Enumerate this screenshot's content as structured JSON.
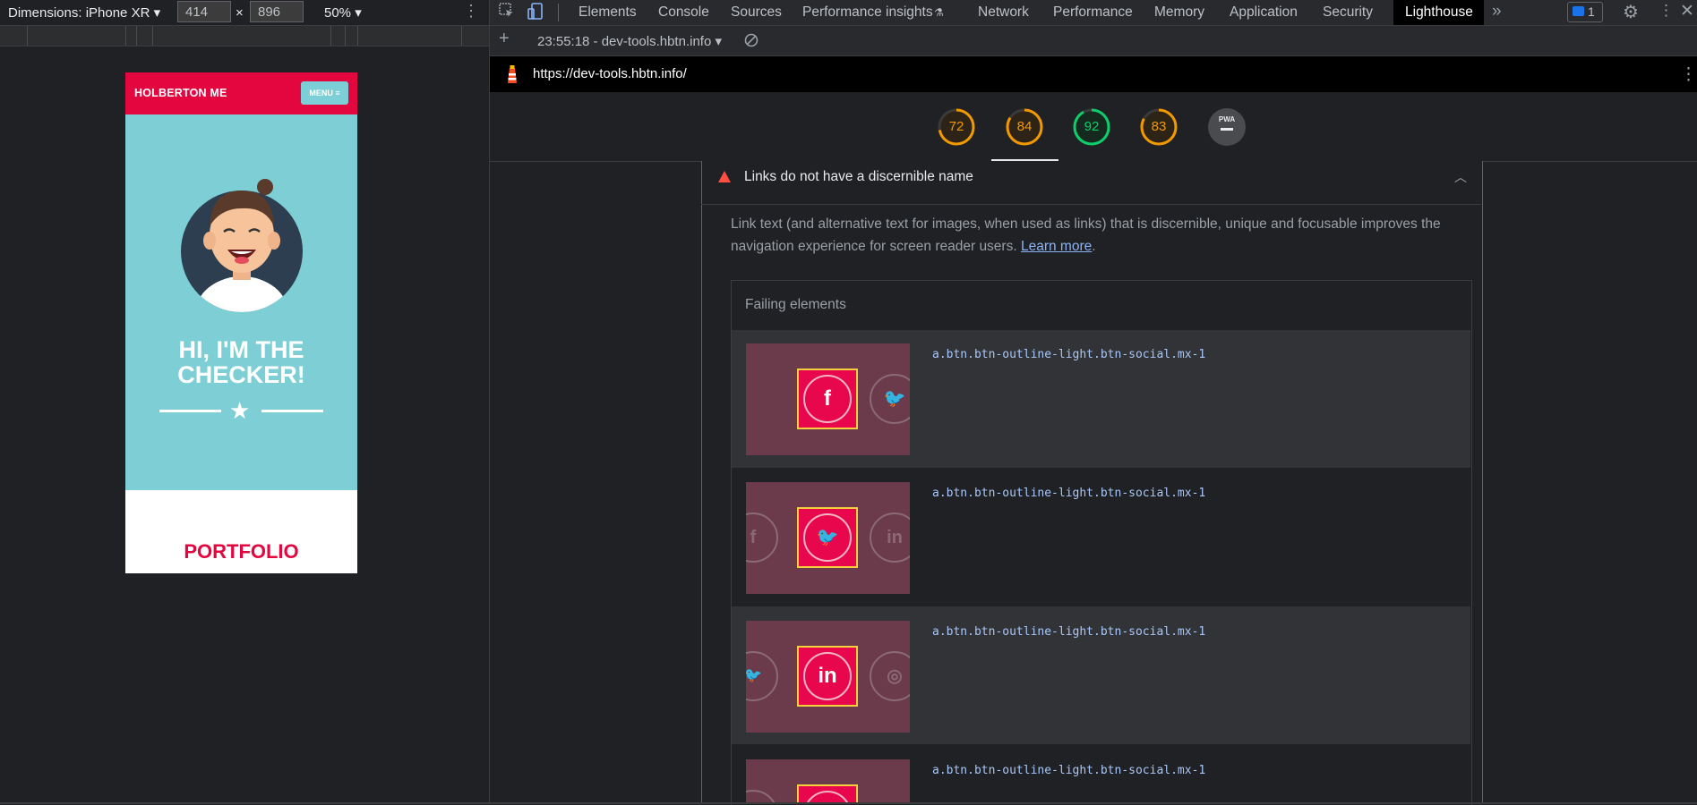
{
  "device_toolbar": {
    "dimensions_label": "Dimensions: iPhone XR",
    "width": "414",
    "times": "×",
    "height": "896",
    "zoom": "50%"
  },
  "phone": {
    "brand": "HOLBERTON ME",
    "menu_label": "MENU ≡",
    "hero_title_line1": "HI, I'M THE",
    "hero_title_line2": "CHECKER!",
    "section_title": "PORTFOLIO"
  },
  "devtools": {
    "tabs": [
      "Elements",
      "Console",
      "Sources",
      "Performance insights",
      "Network",
      "Performance",
      "Memory",
      "Application",
      "Security",
      "Lighthouse"
    ],
    "active_tab": "Lighthouse",
    "issues_count": "1",
    "report_label": "23:55:18 - dev-tools.hbtn.info",
    "url": "https://dev-tools.hbtn.info/",
    "gauges": [
      {
        "value": "72",
        "score": 0.72,
        "color": "#f29900"
      },
      {
        "value": "84",
        "score": 0.84,
        "color": "#f29900"
      },
      {
        "value": "92",
        "score": 0.92,
        "color": "#0cce6b"
      },
      {
        "value": "83",
        "score": 0.83,
        "color": "#f29900"
      },
      {
        "value": "PWA",
        "score": 0,
        "color": "#9aa0a6"
      }
    ],
    "audit": {
      "title": "Links do not have a discernible name",
      "description": "Link text (and alternative text for images, when used as links) that is discernible, unique and focusable improves the navigation experience for screen reader users.",
      "learn_more": "Learn more",
      "period": ".",
      "failing_title": "Failing elements",
      "rows": [
        {
          "selector": "a.btn.btn-outline-light.btn-social.mx-1",
          "icon": "facebook-icon",
          "glyph": "f"
        },
        {
          "selector": "a.btn.btn-outline-light.btn-social.mx-1",
          "icon": "twitter-icon",
          "glyph": "🐦"
        },
        {
          "selector": "a.btn.btn-outline-light.btn-social.mx-1",
          "icon": "linkedin-icon",
          "glyph": "in"
        },
        {
          "selector": "a.btn.btn-outline-light.btn-social.mx-1",
          "icon": "dribbble-icon",
          "glyph": "◎"
        }
      ]
    }
  }
}
